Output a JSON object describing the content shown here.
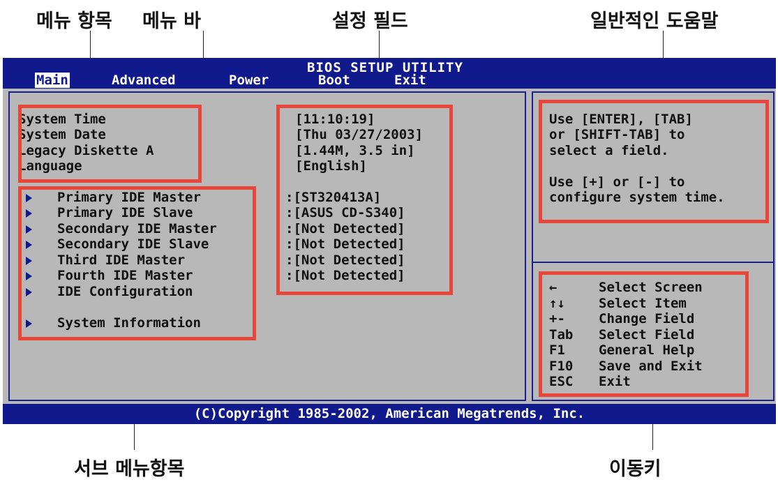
{
  "annotations": {
    "menu_item": "메뉴 항목",
    "menu_bar": "메뉴 바",
    "setting_field": "설정 필드",
    "general_help": "일반적인 도움말",
    "submenu_item": "서브 메뉴항목",
    "nav_keys": "이동키"
  },
  "bios": {
    "title": "BIOS SETUP UTILITY",
    "menus": [
      "Main",
      "Advanced",
      "Power",
      "Boot",
      "Exit"
    ],
    "active_menu": "Main",
    "settings": [
      {
        "label": "System Time",
        "value": "[11:10:19]"
      },
      {
        "label": "System Date",
        "value": "[Thu 03/27/2003]"
      },
      {
        "label": "Legacy Diskette A",
        "value": "[1.44M, 3.5 in]"
      },
      {
        "label": "Language",
        "value": "[English]"
      }
    ],
    "submenus": [
      {
        "label": "Primary IDE Master",
        "value": ":[ST320413A]"
      },
      {
        "label": "Primary IDE Slave",
        "value": ":[ASUS CD-S340]"
      },
      {
        "label": "Secondary IDE Master",
        "value": ":[Not Detected]"
      },
      {
        "label": "Secondary IDE Slave",
        "value": ":[Not Detected]"
      },
      {
        "label": "Third IDE Master",
        "value": ":[Not Detected]"
      },
      {
        "label": "Fourth IDE Master",
        "value": ":[Not Detected]"
      },
      {
        "label": "IDE Configuration",
        "value": ""
      },
      {
        "label": "System Information",
        "value": ""
      }
    ],
    "help": {
      "line1": "Use [ENTER], [TAB]",
      "line2": "or [SHIFT-TAB] to",
      "line3": "select a field.",
      "line4": "Use [+] or [-] to",
      "line5": "configure system time."
    },
    "nav": [
      {
        "key": "←",
        "desc": "Select Screen",
        "key_icon": "left-arrow-icon"
      },
      {
        "key": "↑↓",
        "desc": "Select Item",
        "key_icon": "up-down-arrows-icon"
      },
      {
        "key": "+-",
        "desc": "Change Field"
      },
      {
        "key": "Tab",
        "desc": "Select Field"
      },
      {
        "key": "F1",
        "desc": "General Help"
      },
      {
        "key": "F10",
        "desc": "Save and Exit"
      },
      {
        "key": "ESC",
        "desc": "Exit"
      }
    ],
    "footer": "(C)Copyright 1985-2002, American Megatrends, Inc."
  },
  "colors": {
    "bios_blue": "#111a8c",
    "bios_gray": "#b8b8b8",
    "callout_red": "#e8463a"
  }
}
